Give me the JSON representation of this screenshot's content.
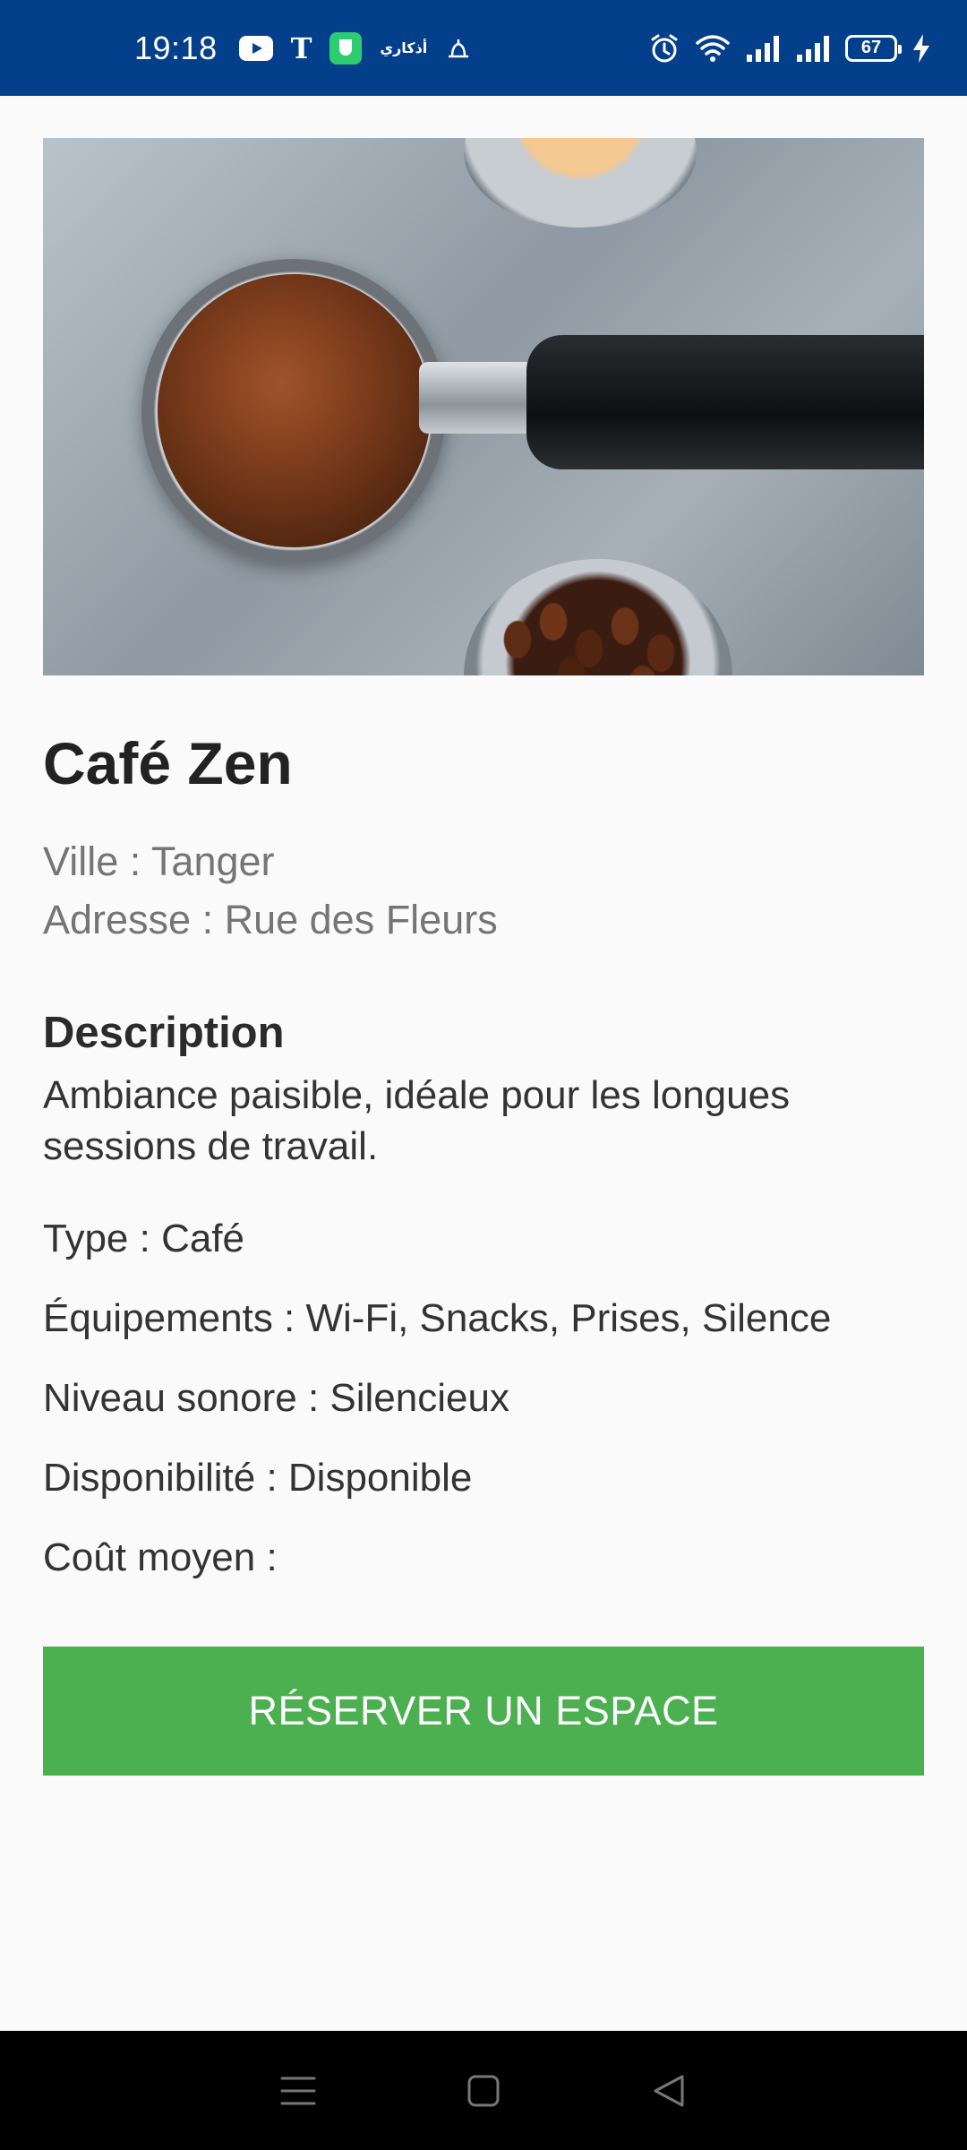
{
  "status_bar": {
    "time": "19:18",
    "left_icons": [
      "youtube-icon",
      "t-icon",
      "shield-icon",
      "arabic-app-icon",
      "bell-icon"
    ],
    "arabic_app_text": "أذكاري",
    "right_icons": [
      "alarm-icon",
      "wifi-icon",
      "signal-icon",
      "signal-icon",
      "battery-icon",
      "charging-icon"
    ],
    "battery_level": "67"
  },
  "place": {
    "title": "Café Zen",
    "city": "Ville : Tanger",
    "address": "Adresse : Rue des Fleurs"
  },
  "description": {
    "heading": "Description",
    "text": "Ambiance paisible, idéale pour les longues sessions de travail."
  },
  "details": {
    "type": "Type : Café",
    "equipment": "Équipements : Wi-Fi, Snacks, Prises, Silence",
    "noise": "Niveau sonore : Silencieux",
    "availability": "Disponibilité : Disponible",
    "cost": "Coût moyen :"
  },
  "actions": {
    "reserve_label": "RÉSERVER UN ESPACE"
  },
  "colors": {
    "status_bar": "#033f8a",
    "button": "#4caf50",
    "background": "#fafafa",
    "nav_bar": "#000000"
  },
  "nav_bar": {
    "icons": [
      "menu-icon",
      "home-icon",
      "back-icon"
    ]
  }
}
